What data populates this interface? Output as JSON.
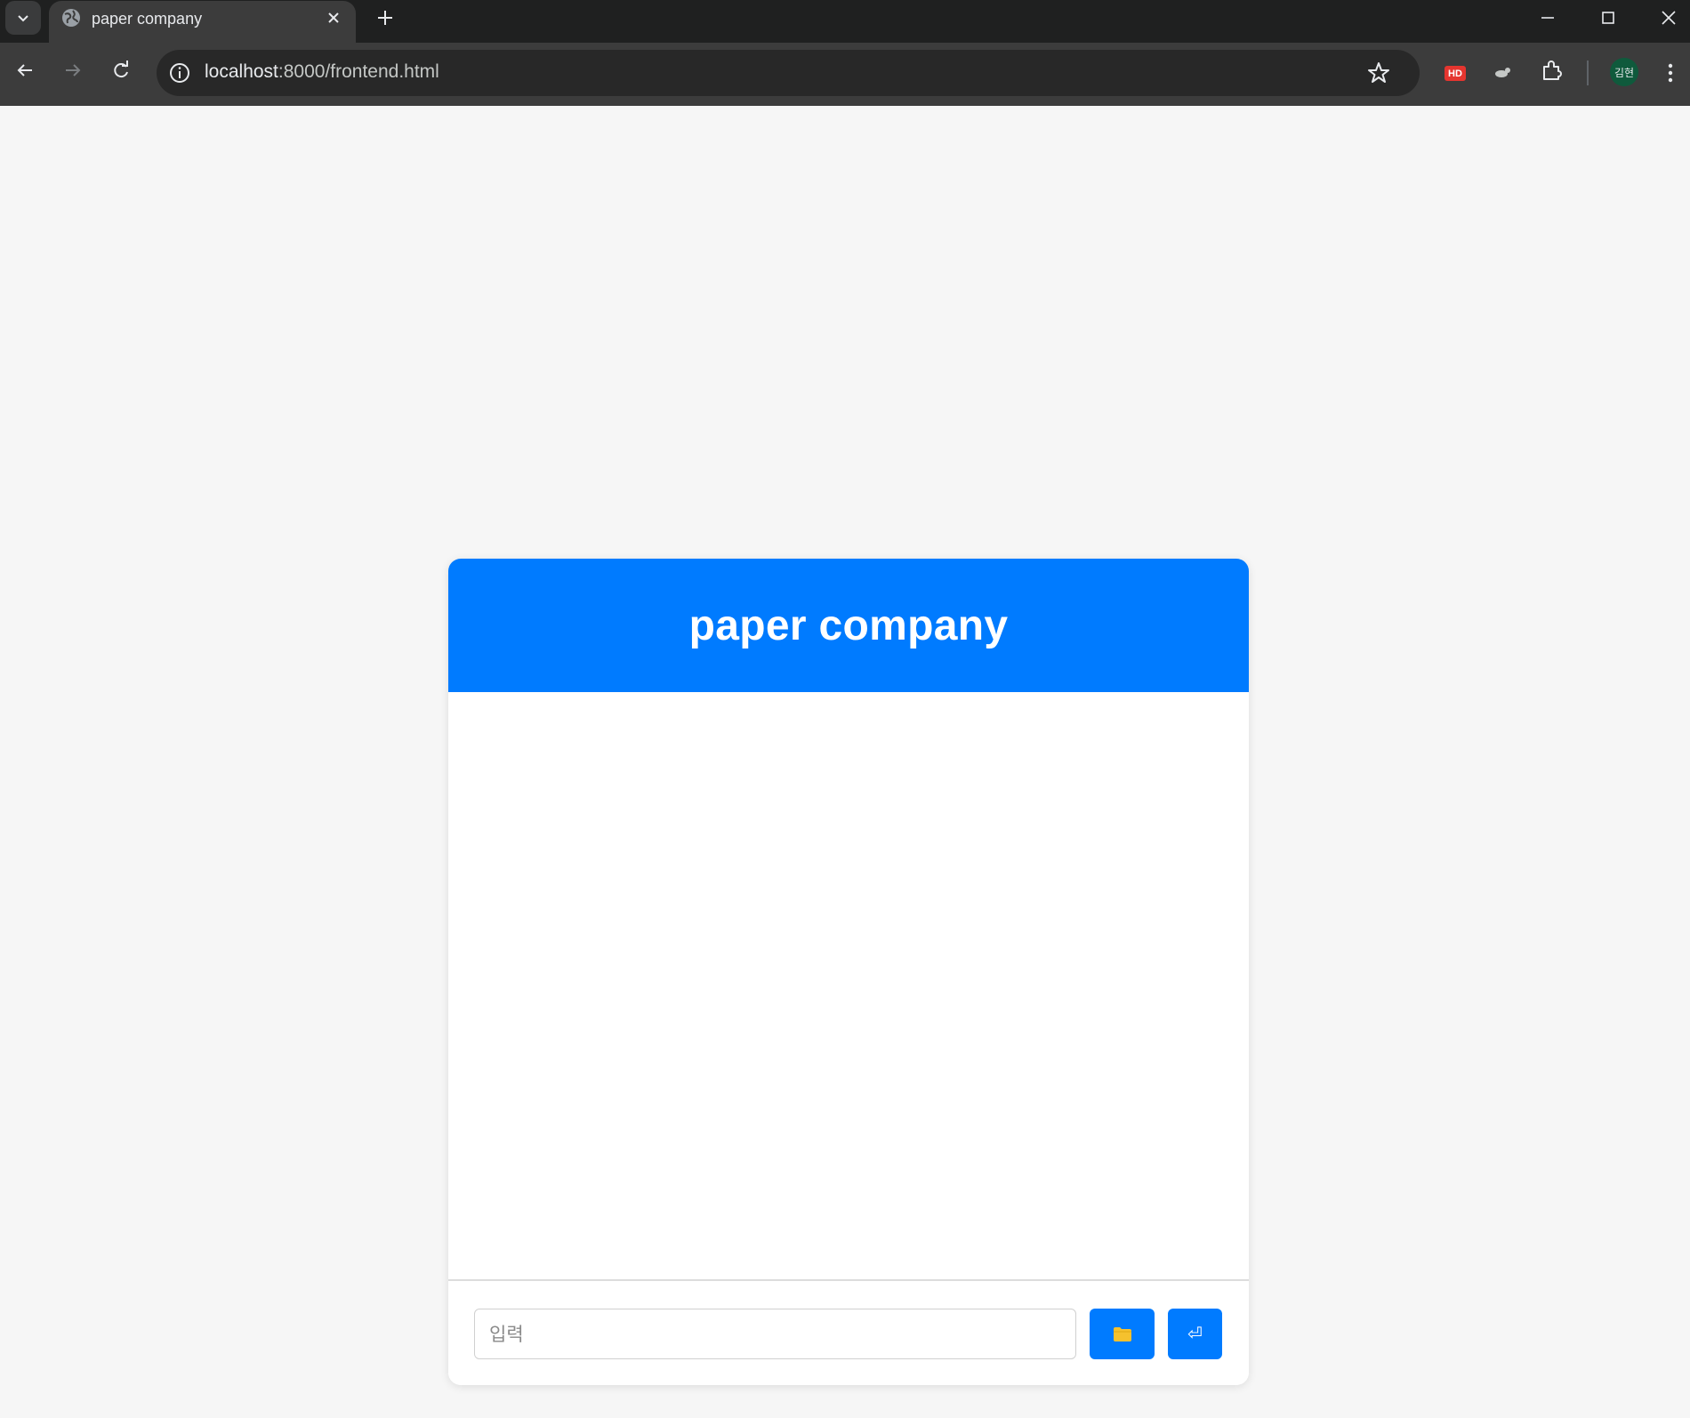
{
  "browser": {
    "tab_title": "paper company",
    "url_host": "localhost",
    "url_path": ":8000/frontend.html",
    "extension_badge": "HD",
    "profile_initials": "김현"
  },
  "chat": {
    "title": "paper company",
    "input_placeholder": "입력",
    "input_value": "",
    "file_button_icon": "folder-icon",
    "send_button_symbol": "⏎"
  },
  "colors": {
    "accent": "#007bff",
    "page_background": "#f6f6f6",
    "folder_icon": "#f5c12e"
  }
}
